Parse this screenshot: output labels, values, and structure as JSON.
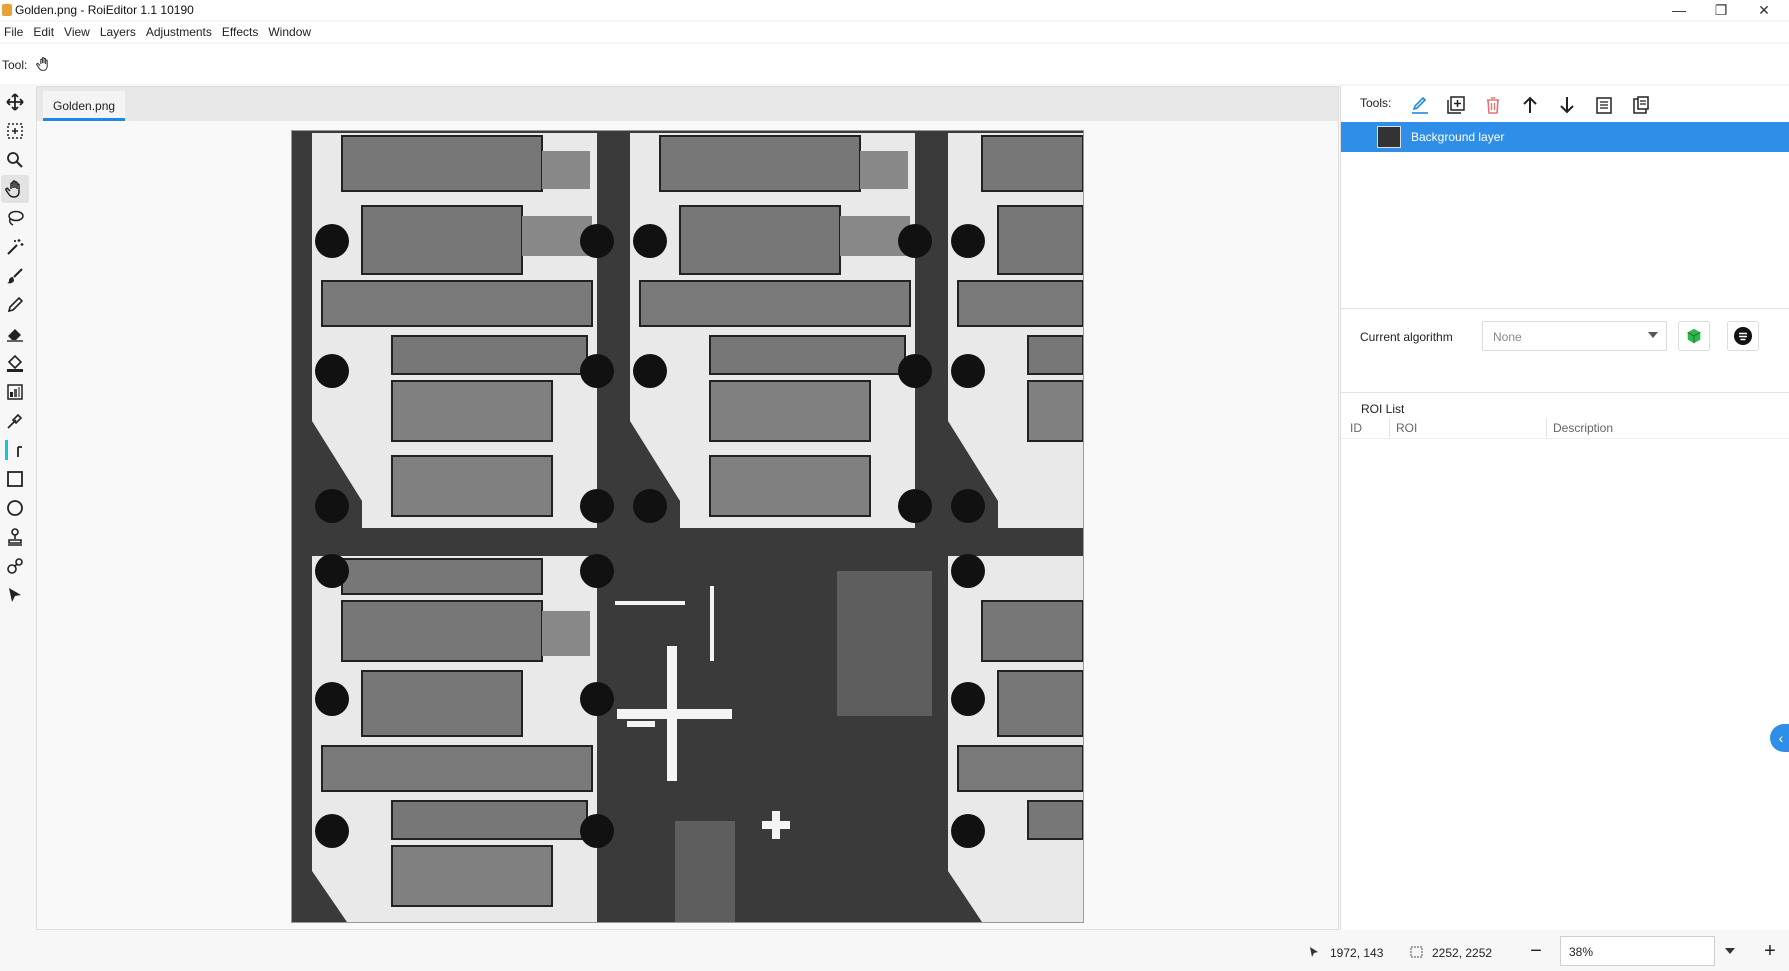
{
  "window": {
    "title": "Golden.png - RoiEditor 1.1 10190",
    "controls": {
      "minimize": "—",
      "restore": "❐",
      "close": "✕"
    }
  },
  "menu": [
    "File",
    "Edit",
    "View",
    "Layers",
    "Adjustments",
    "Effects",
    "Window"
  ],
  "toolbar": {
    "tool_label": "Tool:",
    "current_tool_icon": "hand-icon"
  },
  "toolbox": [
    "move-icon",
    "rect-select-icon",
    "zoom-icon",
    "hand-icon",
    "lasso-icon",
    "magic-wand-icon",
    "paintbrush-icon",
    "pencil-icon",
    "eraser-icon",
    "paint-bucket-icon",
    "gradient-icon",
    "color-picker-icon",
    "text-icon",
    "rectangle-icon",
    "ellipse-icon",
    "clone-stamp-icon",
    "recolor-icon",
    "pointer-icon"
  ],
  "document": {
    "tab_label": "Golden.png"
  },
  "right_panel": {
    "tools_label": "Tools:",
    "tool_icons": [
      "edit-icon",
      "add-layer-icon",
      "delete-icon",
      "move-up-icon",
      "move-down-icon",
      "duplicate-icon",
      "paste-icon"
    ],
    "layers": [
      {
        "name": "Background layer",
        "selected": true
      }
    ],
    "algorithm": {
      "label": "Current algorithm",
      "value": "None"
    },
    "roi_list": {
      "title": "ROI List",
      "columns": [
        "ID",
        "ROI",
        "Description"
      ],
      "rows": []
    }
  },
  "status": {
    "cursor_position": "1972, 143",
    "image_size": "2252, 2252",
    "zoom": "38%",
    "zoom_out": "−",
    "zoom_in": "+"
  },
  "colors": {
    "accent": "#2f8ee8",
    "canvas_bg": "#333333",
    "pad": "#8a8a8a"
  }
}
